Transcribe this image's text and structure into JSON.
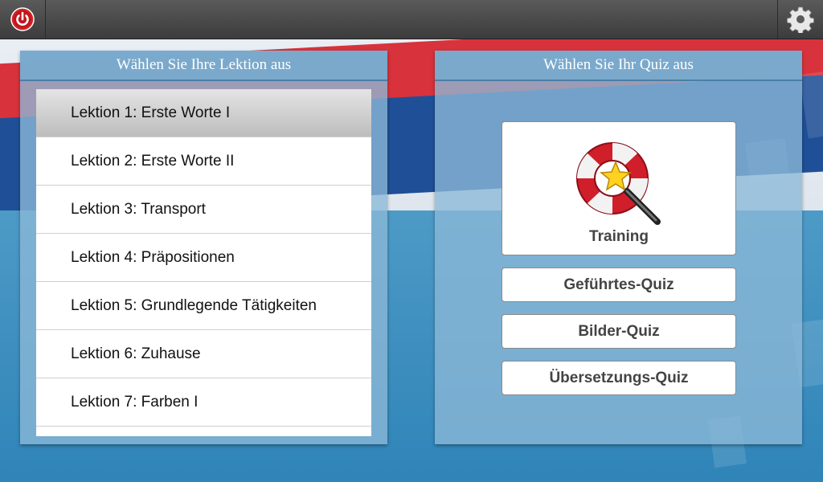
{
  "topbar": {
    "power_icon": "power-icon",
    "settings_icon": "gear-icon"
  },
  "lessons_panel": {
    "title": "Wählen Sie Ihre Lektion aus",
    "items": [
      {
        "label": "Lektion 1: Erste Worte I",
        "selected": true
      },
      {
        "label": "Lektion 2: Erste Worte II",
        "selected": false
      },
      {
        "label": "Lektion 3: Transport",
        "selected": false
      },
      {
        "label": "Lektion 4: Präpositionen",
        "selected": false
      },
      {
        "label": "Lektion 5: Grundlegende Tätigkeiten",
        "selected": false
      },
      {
        "label": "Lektion 6: Zuhause",
        "selected": false
      },
      {
        "label": "Lektion 7: Farben I",
        "selected": false
      }
    ]
  },
  "quiz_panel": {
    "title": "Wählen Sie Ihr Quiz aus",
    "training_label": "Training",
    "training_icon": "lifebuoy-star-magnifier-icon",
    "buttons": [
      {
        "label": "Geführtes-Quiz"
      },
      {
        "label": "Bilder-Quiz"
      },
      {
        "label": "Übersetzungs-Quiz"
      }
    ]
  },
  "colors": {
    "topbar": "#4a4a4a",
    "accent_red": "#d8323c",
    "sea_blue": "#3a8ab8",
    "panel_header": "#78aacd"
  }
}
